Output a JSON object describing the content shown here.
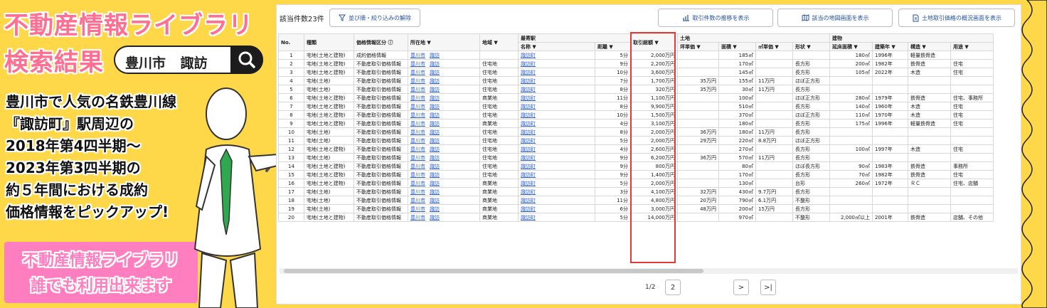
{
  "banner": {
    "title1": "不動産情報ライブラリ",
    "title2": "検索結果",
    "search_text": "豊川市 諏訪",
    "desc_lines": [
      "豊川市で人気の名鉄豊川線",
      "『諏訪町』駅周辺の",
      "2018年第4四半期～",
      "2023年第3四半期の",
      "約５年間における成約",
      "価格情報をピックアップ!"
    ],
    "promo1": "不動産情報ライブラリ",
    "promo2": "誰でも利用出来ます"
  },
  "toolbar": {
    "count": "該当件数23件",
    "reset": "並び順・絞り込みの解除",
    "trend": "取引件数の推移を表示",
    "map": "該当の地図画面を表示",
    "overview": "土地取引価格の概況画面を表示"
  },
  "headers": {
    "no": "No.",
    "type": "種類",
    "price_info": "価格情報区分",
    "location": "所在地 ▼",
    "area_use": "地域 ▼",
    "station": "最寄駅",
    "st_name": "名称 ▼",
    "st_dist": "距離 ▼",
    "total": "取引総額 ▼",
    "land": "土地",
    "tsubo": "坪単価 ▼",
    "land_area": "面積 ▼",
    "m2": "㎡単価 ▼",
    "shape": "形状 ▼",
    "building": "建物",
    "floor": "延床面積 ▼",
    "year": "建築年 ▼",
    "structure": "構造 ▼",
    "use": "用途 ▼"
  },
  "rows": [
    {
      "no": "1",
      "type": "宅地(土地と建物)",
      "pi": "成約価格情報",
      "c": "豊川市",
      "t": "諏訪",
      "zone": "",
      "st": "諏訪町",
      "dist": "5分",
      "total": "2,000万円",
      "tsubo": "",
      "area": "185㎡",
      "m2": "",
      "shape": "",
      "floor": "180㎡",
      "year": "1996年",
      "str": "軽量鉄骨造",
      "use": ""
    },
    {
      "no": "2",
      "type": "宅地(土地と建物)",
      "pi": "不動産取引価格情報",
      "c": "豊川市",
      "t": "諏訪",
      "zone": "住宅地",
      "st": "諏訪町",
      "dist": "9分",
      "total": "2,200万円",
      "tsubo": "",
      "area": "170㎡",
      "m2": "",
      "shape": "長方形",
      "floor": "200㎡",
      "year": "1982年",
      "str": "鉄骨造",
      "use": "住宅"
    },
    {
      "no": "3",
      "type": "宅地(土地と建物)",
      "pi": "不動産取引価格情報",
      "c": "豊川市",
      "t": "諏訪",
      "zone": "住宅地",
      "st": "諏訪町",
      "dist": "10分",
      "total": "3,600万円",
      "tsubo": "",
      "area": "145㎡",
      "m2": "",
      "shape": "長方形",
      "floor": "105㎡",
      "year": "2022年",
      "str": "木造",
      "use": "住宅"
    },
    {
      "no": "4",
      "type": "宅地(土地)",
      "pi": "不動産取引価格情報",
      "c": "豊川市",
      "t": "諏訪",
      "zone": "住宅地",
      "st": "諏訪町",
      "dist": "7分",
      "total": "1,700万円",
      "tsubo": "35万円",
      "area": "155㎡",
      "m2": "11万円",
      "shape": "ほぼ正方形",
      "floor": "",
      "year": "",
      "str": "",
      "use": ""
    },
    {
      "no": "5",
      "type": "宅地(土地)",
      "pi": "不動産取引価格情報",
      "c": "豊川市",
      "t": "諏訪",
      "zone": "住宅地",
      "st": "諏訪町",
      "dist": "8分",
      "total": "320万円",
      "tsubo": "35万円",
      "area": "30㎡",
      "m2": "11万円",
      "shape": "長方形",
      "floor": "",
      "year": "",
      "str": "",
      "use": ""
    },
    {
      "no": "6",
      "type": "宅地(土地と建物)",
      "pi": "不動産取引価格情報",
      "c": "豊川市",
      "t": "諏訪",
      "zone": "商業地",
      "st": "諏訪町",
      "dist": "11分",
      "total": "1,100万円",
      "tsubo": "",
      "area": "100㎡",
      "m2": "",
      "shape": "ほぼ正方形",
      "floor": "280㎡",
      "year": "1979年",
      "str": "鉄骨造",
      "use": "住宅、事務所"
    },
    {
      "no": "7",
      "type": "宅地(土地と建物)",
      "pi": "不動産取引価格情報",
      "c": "豊川市",
      "t": "諏訪",
      "zone": "住宅地",
      "st": "諏訪町",
      "dist": "8分",
      "total": "9,900万円",
      "tsubo": "",
      "area": "510㎡",
      "m2": "",
      "shape": "長方形",
      "floor": "140㎡",
      "year": "1960年",
      "str": "木造",
      "use": "住宅"
    },
    {
      "no": "8",
      "type": "宅地(土地と建物)",
      "pi": "不動産取引価格情報",
      "c": "豊川市",
      "t": "諏訪",
      "zone": "住宅地",
      "st": "諏訪町",
      "dist": "10分",
      "total": "1,500万円",
      "tsubo": "",
      "area": "370㎡",
      "m2": "",
      "shape": "ほぼ正方形",
      "floor": "110㎡",
      "year": "1970年",
      "str": "木造",
      "use": "住宅"
    },
    {
      "no": "9",
      "type": "宅地(土地と建物)",
      "pi": "不動産取引価格情報",
      "c": "豊川市",
      "t": "諏訪",
      "zone": "商業地",
      "st": "諏訪町",
      "dist": "4分",
      "total": "3,100万円",
      "tsubo": "",
      "area": "180㎡",
      "m2": "",
      "shape": "長方形",
      "floor": "175㎡",
      "year": "1996年",
      "str": "軽量鉄骨造",
      "use": "住宅"
    },
    {
      "no": "10",
      "type": "宅地(土地)",
      "pi": "不動産取引価格情報",
      "c": "豊川市",
      "t": "諏訪",
      "zone": "住宅地",
      "st": "諏訪町",
      "dist": "8分",
      "total": "2,000万円",
      "tsubo": "36万円",
      "area": "180㎡",
      "m2": "11万円",
      "shape": "長方形",
      "floor": "",
      "year": "",
      "str": "",
      "use": ""
    },
    {
      "no": "11",
      "type": "宅地(土地)",
      "pi": "不動産取引価格情報",
      "c": "豊川市",
      "t": "諏訪",
      "zone": "住宅地",
      "st": "諏訪町",
      "dist": "5分",
      "total": "2,000万円",
      "tsubo": "29万円",
      "area": "220㎡",
      "m2": "8.8万円",
      "shape": "ほぼ正方形",
      "floor": "",
      "year": "",
      "str": "",
      "use": ""
    },
    {
      "no": "12",
      "type": "宅地(土地と建物)",
      "pi": "不動産取引価格情報",
      "c": "豊川市",
      "t": "諏訪",
      "zone": "住宅地",
      "st": "諏訪町",
      "dist": "4分",
      "total": "2,600万円",
      "tsubo": "",
      "area": "270㎡",
      "m2": "",
      "shape": "長方形",
      "floor": "100㎡",
      "year": "1997年",
      "str": "木造",
      "use": "住宅"
    },
    {
      "no": "13",
      "type": "宅地(土地)",
      "pi": "不動産取引価格情報",
      "c": "豊川市",
      "t": "諏訪",
      "zone": "住宅地",
      "st": "諏訪町",
      "dist": "9分",
      "total": "6,200万円",
      "tsubo": "36万円",
      "area": "570㎡",
      "m2": "11万円",
      "shape": "長方形",
      "floor": "",
      "year": "",
      "str": "",
      "use": ""
    },
    {
      "no": "14",
      "type": "宅地(土地と建物)",
      "pi": "不動産取引価格情報",
      "c": "豊川市",
      "t": "諏訪",
      "zone": "住宅地",
      "st": "諏訪町",
      "dist": "9分",
      "total": "800万円",
      "tsubo": "",
      "area": "80㎡",
      "m2": "",
      "shape": "ほぼ長方形",
      "floor": "90㎡",
      "year": "1983年",
      "str": "鉄骨造",
      "use": "事務所"
    },
    {
      "no": "15",
      "type": "宅地(土地と建物)",
      "pi": "不動産取引価格情報",
      "c": "豊川市",
      "t": "諏訪",
      "zone": "住宅地",
      "st": "諏訪町",
      "dist": "9分",
      "total": "1,400万円",
      "tsubo": "",
      "area": "170㎡",
      "m2": "",
      "shape": "長方形",
      "floor": "70㎡",
      "year": "1982年",
      "str": "鉄骨造",
      "use": "住宅"
    },
    {
      "no": "16",
      "type": "宅地(土地と建物)",
      "pi": "不動産取引価格情報",
      "c": "豊川市",
      "t": "諏訪",
      "zone": "商業地",
      "st": "諏訪町",
      "dist": "5分",
      "total": "2,000万円",
      "tsubo": "",
      "area": "130㎡",
      "m2": "",
      "shape": "台形",
      "floor": "260㎡",
      "year": "1972年",
      "str": "ＲＣ",
      "use": "住宅、店舗"
    },
    {
      "no": "17",
      "type": "宅地(土地)",
      "pi": "不動産取引価格情報",
      "c": "豊川市",
      "t": "諏訪",
      "zone": "商業地",
      "st": "諏訪町",
      "dist": "3分",
      "total": "4,100万円",
      "tsubo": "32万円",
      "area": "430㎡",
      "m2": "9.7万円",
      "shape": "長方形",
      "floor": "",
      "year": "",
      "str": "",
      "use": ""
    },
    {
      "no": "18",
      "type": "宅地(土地)",
      "pi": "不動産取引価格情報",
      "c": "豊川市",
      "t": "諏訪",
      "zone": "商業地",
      "st": "諏訪町",
      "dist": "11分",
      "total": "4,800万円",
      "tsubo": "20万円",
      "area": "790㎡",
      "m2": "6.1万円",
      "shape": "不整形",
      "floor": "",
      "year": "",
      "str": "",
      "use": ""
    },
    {
      "no": "19",
      "type": "宅地(土地)",
      "pi": "不動産取引価格情報",
      "c": "豊川市",
      "t": "諏訪",
      "zone": "商業地",
      "st": "諏訪町",
      "dist": "6分",
      "total": "3,000万円",
      "tsubo": "48万円",
      "area": "200㎡",
      "m2": "15万円",
      "shape": "長方形",
      "floor": "",
      "year": "",
      "str": "",
      "use": ""
    },
    {
      "no": "20",
      "type": "宅地(土地と建物)",
      "pi": "不動産取引価格情報",
      "c": "豊川市",
      "t": "諏訪",
      "zone": "商業地",
      "st": "諏訪町",
      "dist": "5分",
      "total": "14,000万円",
      "tsubo": "",
      "area": "970㎡",
      "m2": "",
      "shape": "不整形",
      "floor": "2,000㎡以上",
      "year": "2001年",
      "str": "鉄骨造",
      "use": "店舗、その他"
    }
  ],
  "pager": {
    "info": "1/2",
    "page2": "2",
    "next": ">",
    "last": ">|"
  },
  "colors": {
    "accent_pink": "#ff6f91",
    "background": "#ffd84a",
    "link": "#2b5fd0",
    "highlight": "#e53935"
  }
}
